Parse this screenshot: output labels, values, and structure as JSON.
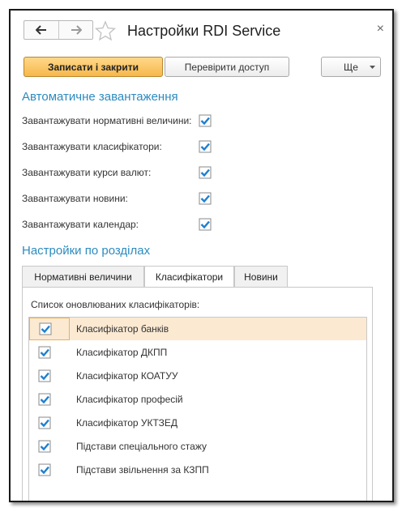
{
  "window": {
    "title": "Настройки RDI Service",
    "close_label": "×"
  },
  "toolbar": {
    "save_close_label": "Записати і закрити",
    "check_access_label": "Перевірити доступ",
    "more_label": "Ще"
  },
  "auto_load": {
    "title": "Автоматичне завантаження",
    "items": [
      {
        "label": "Завантажувати нормативні величини:",
        "checked": true
      },
      {
        "label": "Завантажувати класифікатори:",
        "checked": true
      },
      {
        "label": "Завантажувати курси валют:",
        "checked": true
      },
      {
        "label": "Завантажувати новини:",
        "checked": true
      },
      {
        "label": "Завантажувати календар:",
        "checked": true
      }
    ]
  },
  "sections": {
    "title": "Настройки по розділах",
    "tabs": [
      {
        "label": "Нормативні величини",
        "active": false
      },
      {
        "label": "Класифікатори",
        "active": true
      },
      {
        "label": "Новини",
        "active": false
      }
    ]
  },
  "classifiers": {
    "caption": "Список оновлюваних класифікаторів:",
    "rows": [
      {
        "name": "Класифікатор банків",
        "checked": true,
        "selected": true
      },
      {
        "name": "Класифікатор ДКПП",
        "checked": true,
        "selected": false
      },
      {
        "name": "Класифікатор КОАТУУ",
        "checked": true,
        "selected": false
      },
      {
        "name": "Класифікатор професій",
        "checked": true,
        "selected": false
      },
      {
        "name": "Класифікатор УКТЗЕД",
        "checked": true,
        "selected": false
      },
      {
        "name": "Підстави спеціального стажу",
        "checked": true,
        "selected": false
      },
      {
        "name": "Підстави звільнення за КЗПП",
        "checked": true,
        "selected": false
      }
    ]
  },
  "colors": {
    "accent": "#2c8bbf",
    "primary_button": "#f7b84a",
    "checkbox": "#1e7fd0",
    "selected_row": "#fbe9d2"
  },
  "icons": {
    "back": "arrow-left-icon",
    "forward": "arrow-right-icon",
    "favorite": "star-icon",
    "close": "close-icon",
    "dropdown": "chevron-down-icon",
    "checkbox": "checkbox-checked-icon"
  }
}
